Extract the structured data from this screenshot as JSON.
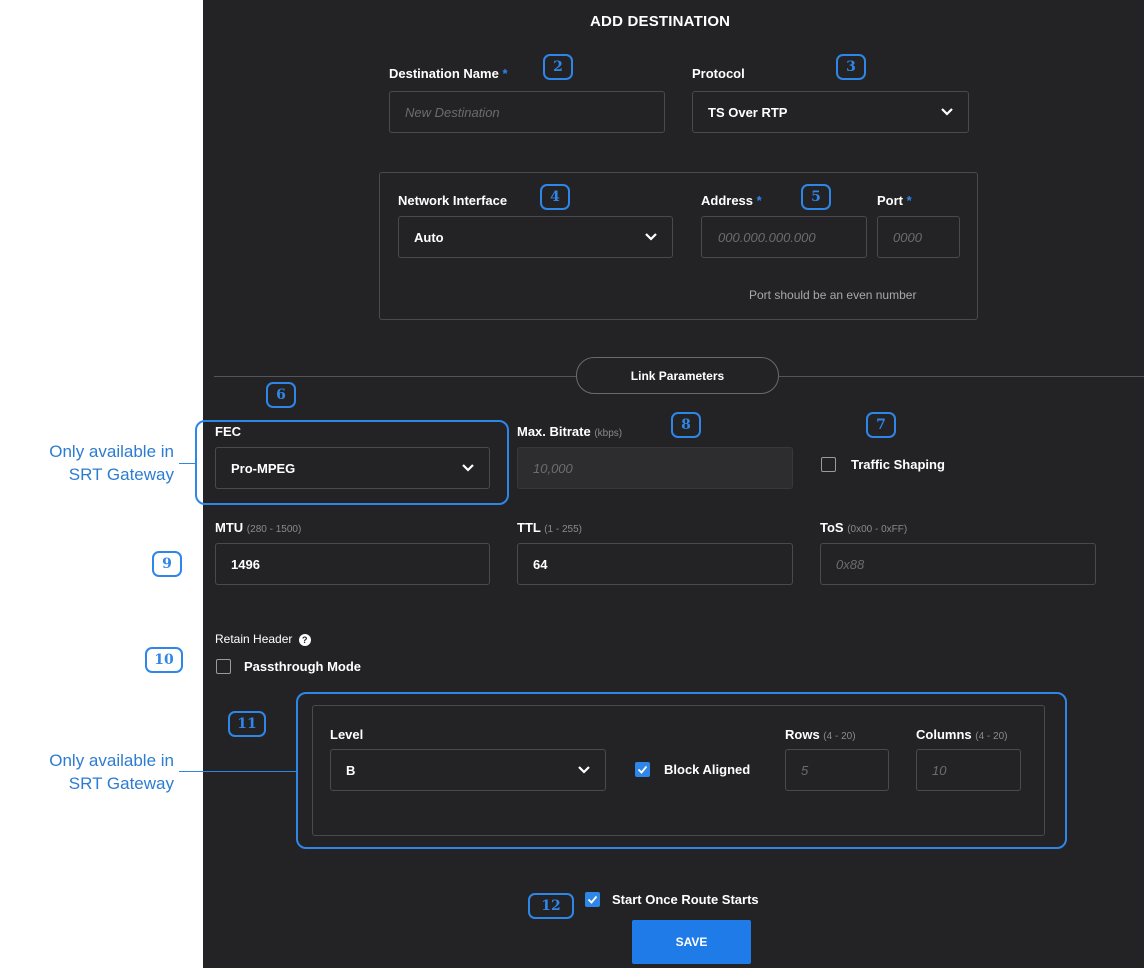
{
  "title": "ADD DESTINATION",
  "destination_name": {
    "label": "Destination Name",
    "required": "*",
    "placeholder": "New Destination"
  },
  "protocol": {
    "label": "Protocol",
    "value": "TS Over RTP"
  },
  "network_interface": {
    "label": "Network Interface",
    "value": "Auto"
  },
  "address": {
    "label": "Address",
    "required": "*",
    "placeholder": "000.000.000.000"
  },
  "port": {
    "label": "Port",
    "required": "*",
    "placeholder": "0000",
    "hint": "Port should be an even number"
  },
  "link_parameters": "Link Parameters",
  "fec": {
    "label": "FEC",
    "value": "Pro-MPEG"
  },
  "max_bitrate": {
    "label": "Max. Bitrate",
    "hint": "(kbps)",
    "placeholder": "10,000"
  },
  "traffic_shaping": {
    "label": "Traffic Shaping",
    "checked": false
  },
  "mtu": {
    "label": "MTU",
    "hint": "(280 - 1500)",
    "value": "1496"
  },
  "ttl": {
    "label": "TTL",
    "hint": "(1 - 255)",
    "value": "64"
  },
  "tos": {
    "label": "ToS",
    "hint": "(0x00 - 0xFF)",
    "placeholder": "0x88"
  },
  "retain_header": {
    "label": "Retain Header",
    "help_icon": "question-icon"
  },
  "passthrough_mode": {
    "label": "Passthrough Mode",
    "checked": false
  },
  "level": {
    "label": "Level",
    "value": "B"
  },
  "block_aligned": {
    "label": "Block Aligned",
    "checked": true
  },
  "rows": {
    "label": "Rows",
    "hint": "(4 - 20)",
    "placeholder": "5"
  },
  "columns": {
    "label": "Columns",
    "hint": "(4 - 20)",
    "placeholder": "10"
  },
  "start_once": {
    "label": "Start Once Route Starts",
    "checked": true
  },
  "save_label": "SAVE",
  "callouts": {
    "c2": "2",
    "c3": "3",
    "c4": "4",
    "c5": "5",
    "c6": "6",
    "c7": "7",
    "c8": "8",
    "c9": "9",
    "c10": "10",
    "c11": "11",
    "c12": "12"
  },
  "annotations": {
    "fec_note": {
      "line1": "Only available in",
      "line2": "SRT Gateway"
    },
    "fec_options_note": {
      "line1": "Only available in",
      "line2": "SRT Gateway"
    }
  },
  "colors": {
    "panel": "#232325",
    "accent": "#2f86e9",
    "button": "#1f7be8"
  }
}
